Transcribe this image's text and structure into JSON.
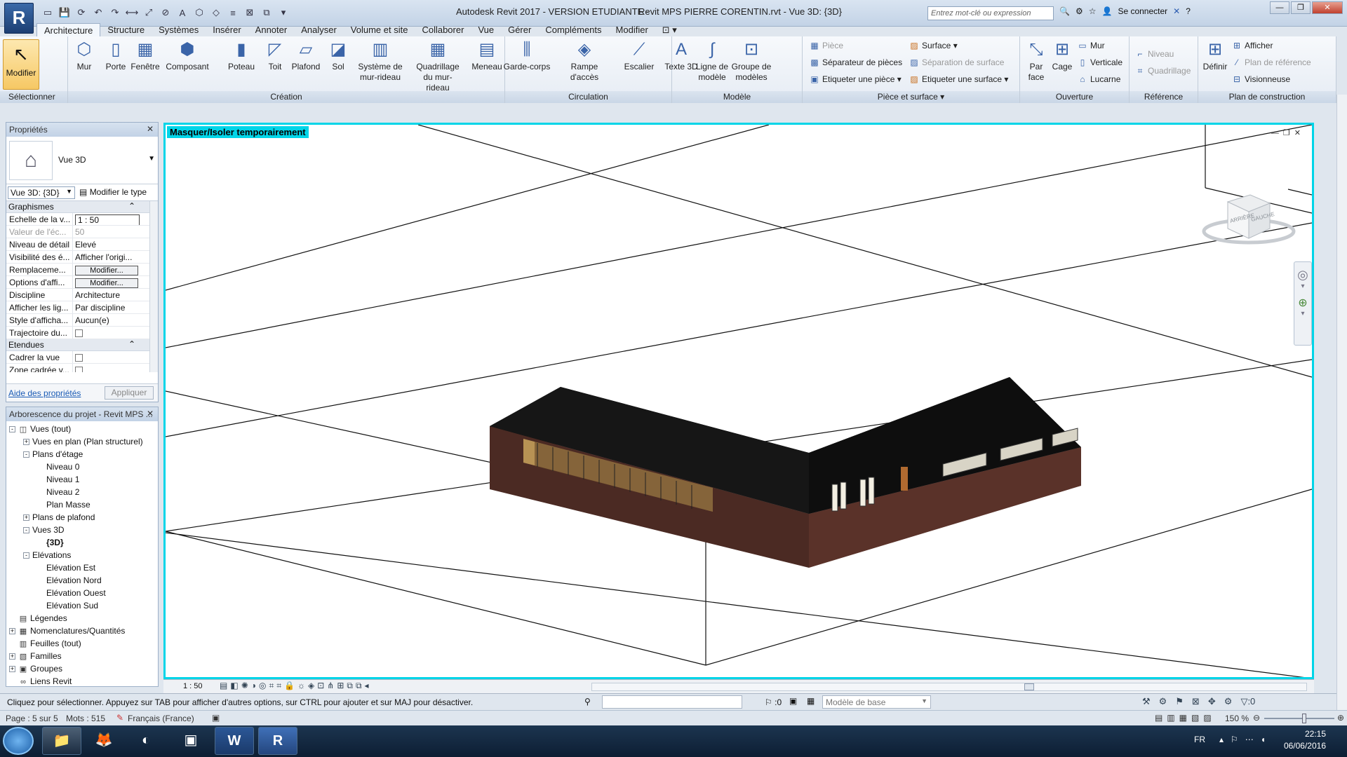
{
  "titlebar": {
    "logo": "R",
    "app_title": "Autodesk Revit 2017 - VERSION ETUDIANTE -",
    "file_title": "Revit MPS PIERRE CORENTIN.rvt - Vue 3D: {3D}",
    "search_placeholder": "Entrez mot-clé ou expression",
    "signin": "Se connecter"
  },
  "tabs": [
    "Architecture",
    "Structure",
    "Systèmes",
    "Insérer",
    "Annoter",
    "Analyser",
    "Volume et site",
    "Collaborer",
    "Vue",
    "Gérer",
    "Compléments",
    "Modifier"
  ],
  "ribbon": {
    "select_panel": {
      "button": "Modifier",
      "label": "Sélectionner"
    },
    "creation": {
      "label": "Création",
      "buttons": [
        "Mur",
        "Porte",
        "Fenêtre",
        "Composant",
        "Poteau",
        "Toit",
        "Plafond",
        "Sol",
        "Système de mur-rideau",
        "Quadrillage du mur-rideau",
        "Meneau"
      ]
    },
    "circulation": {
      "label": "Circulation",
      "buttons": [
        "Garde-corps",
        "Rampe d'accès",
        "Escalier"
      ]
    },
    "modele": {
      "label": "Modèle",
      "buttons": [
        "Texte 3D",
        "Ligne de modèle",
        "Groupe de modèles"
      ]
    },
    "piece": {
      "label": "Pièce et surface",
      "items": [
        "Pièce",
        "Séparateur de pièces",
        "Etiqueter une pièce",
        "Surface",
        "Séparation de surface",
        "Etiqueter une surface"
      ]
    },
    "ouverture": {
      "label": "Ouverture",
      "buttons": [
        "Par face",
        "Cage"
      ],
      "items": [
        "Mur",
        "Verticale",
        "Lucarne"
      ]
    },
    "reference": {
      "label": "Référence",
      "items": [
        "Niveau",
        "Quadrillage"
      ]
    },
    "plan": {
      "label": "Plan de construction",
      "button": "Définir",
      "items": [
        "Afficher",
        "Plan de référence",
        "Visionneuse"
      ]
    }
  },
  "properties": {
    "title": "Propriétés",
    "type_name": "Vue 3D",
    "selector": "Vue 3D: {3D}",
    "edit_type": "Modifier le type",
    "groups": [
      {
        "name": "Graphismes",
        "rows": [
          {
            "k": "Echelle de la v...",
            "v": "1 : 50",
            "kind": "input"
          },
          {
            "k": "Valeur de l'éc...",
            "v": "50",
            "kind": "dim"
          },
          {
            "k": "Niveau de détail",
            "v": "Elevé",
            "kind": "text"
          },
          {
            "k": "Visibilité des é...",
            "v": "Afficher l'origi...",
            "kind": "text"
          },
          {
            "k": "Remplaceme...",
            "v": "Modifier...",
            "kind": "button"
          },
          {
            "k": "Options d'affi...",
            "v": "Modifier...",
            "kind": "button"
          },
          {
            "k": "Discipline",
            "v": "Architecture",
            "kind": "text"
          },
          {
            "k": "Afficher les lig...",
            "v": "Par discipline",
            "kind": "text"
          },
          {
            "k": "Style d'afficha...",
            "v": "Aucun(e)",
            "kind": "text"
          },
          {
            "k": "Trajectoire du...",
            "v": "",
            "kind": "check"
          }
        ]
      },
      {
        "name": "Etendues",
        "rows": [
          {
            "k": "Cadrer la vue",
            "v": "",
            "kind": "check"
          },
          {
            "k": "Zone cadrée v...",
            "v": "",
            "kind": "check"
          },
          {
            "k": "Cadrage de l'a...",
            "v": "",
            "kind": "check"
          }
        ]
      }
    ],
    "help": "Aide des propriétés",
    "apply": "Appliquer"
  },
  "browser": {
    "title": "Arborescence du projet - Revit MPS ...",
    "nodes": [
      {
        "label": "Vues (tout)",
        "depth": 0,
        "ex": "-",
        "icon": "views-icon"
      },
      {
        "label": "Vues en plan (Plan structurel)",
        "depth": 1,
        "ex": "+"
      },
      {
        "label": "Plans d'étage",
        "depth": 1,
        "ex": "-"
      },
      {
        "label": "Niveau 0",
        "depth": 2
      },
      {
        "label": "Niveau 1",
        "depth": 2
      },
      {
        "label": "Niveau 2",
        "depth": 2
      },
      {
        "label": "Plan Masse",
        "depth": 2
      },
      {
        "label": "Plans de plafond",
        "depth": 1,
        "ex": "+"
      },
      {
        "label": "Vues 3D",
        "depth": 1,
        "ex": "-"
      },
      {
        "label": "{3D}",
        "depth": 2,
        "bold": true
      },
      {
        "label": "Elévations",
        "depth": 1,
        "ex": "-"
      },
      {
        "label": "Elévation Est",
        "depth": 2
      },
      {
        "label": "Elévation Nord",
        "depth": 2
      },
      {
        "label": "Elévation Ouest",
        "depth": 2
      },
      {
        "label": "Elévation Sud",
        "depth": 2
      },
      {
        "label": "Légendes",
        "depth": 0,
        "icon": "legend-icon"
      },
      {
        "label": "Nomenclatures/Quantités",
        "depth": 0,
        "ex": "+",
        "icon": "schedule-icon"
      },
      {
        "label": "Feuilles (tout)",
        "depth": 0,
        "icon": "sheet-icon"
      },
      {
        "label": "Familles",
        "depth": 0,
        "ex": "+",
        "icon": "family-icon"
      },
      {
        "label": "Groupes",
        "depth": 0,
        "ex": "+",
        "icon": "group-icon"
      },
      {
        "label": "Liens Revit",
        "depth": 0,
        "icon": "link-icon"
      }
    ]
  },
  "view": {
    "banner": "Masquer/Isoler temporairement",
    "viewcube_top": "ARRIÈRE",
    "viewcube_side": "GAUCHE",
    "scale": "1 : 50"
  },
  "status": {
    "message": "Cliquez pour sélectionner. Appuyez sur TAB pour afficher d'autres options, sur CTRL pour ajouter et sur MAJ pour désactiver.",
    "zero": ":0",
    "model": "Modèle de base",
    "filter": ":0"
  },
  "wordbar": {
    "page": "Page : 5 sur 5",
    "words": "Mots : 515",
    "lang": "Français (France)",
    "zoom": "150 %"
  },
  "taskbar": {
    "lang": "FR",
    "time": "22:15",
    "date": "06/06/2016"
  }
}
